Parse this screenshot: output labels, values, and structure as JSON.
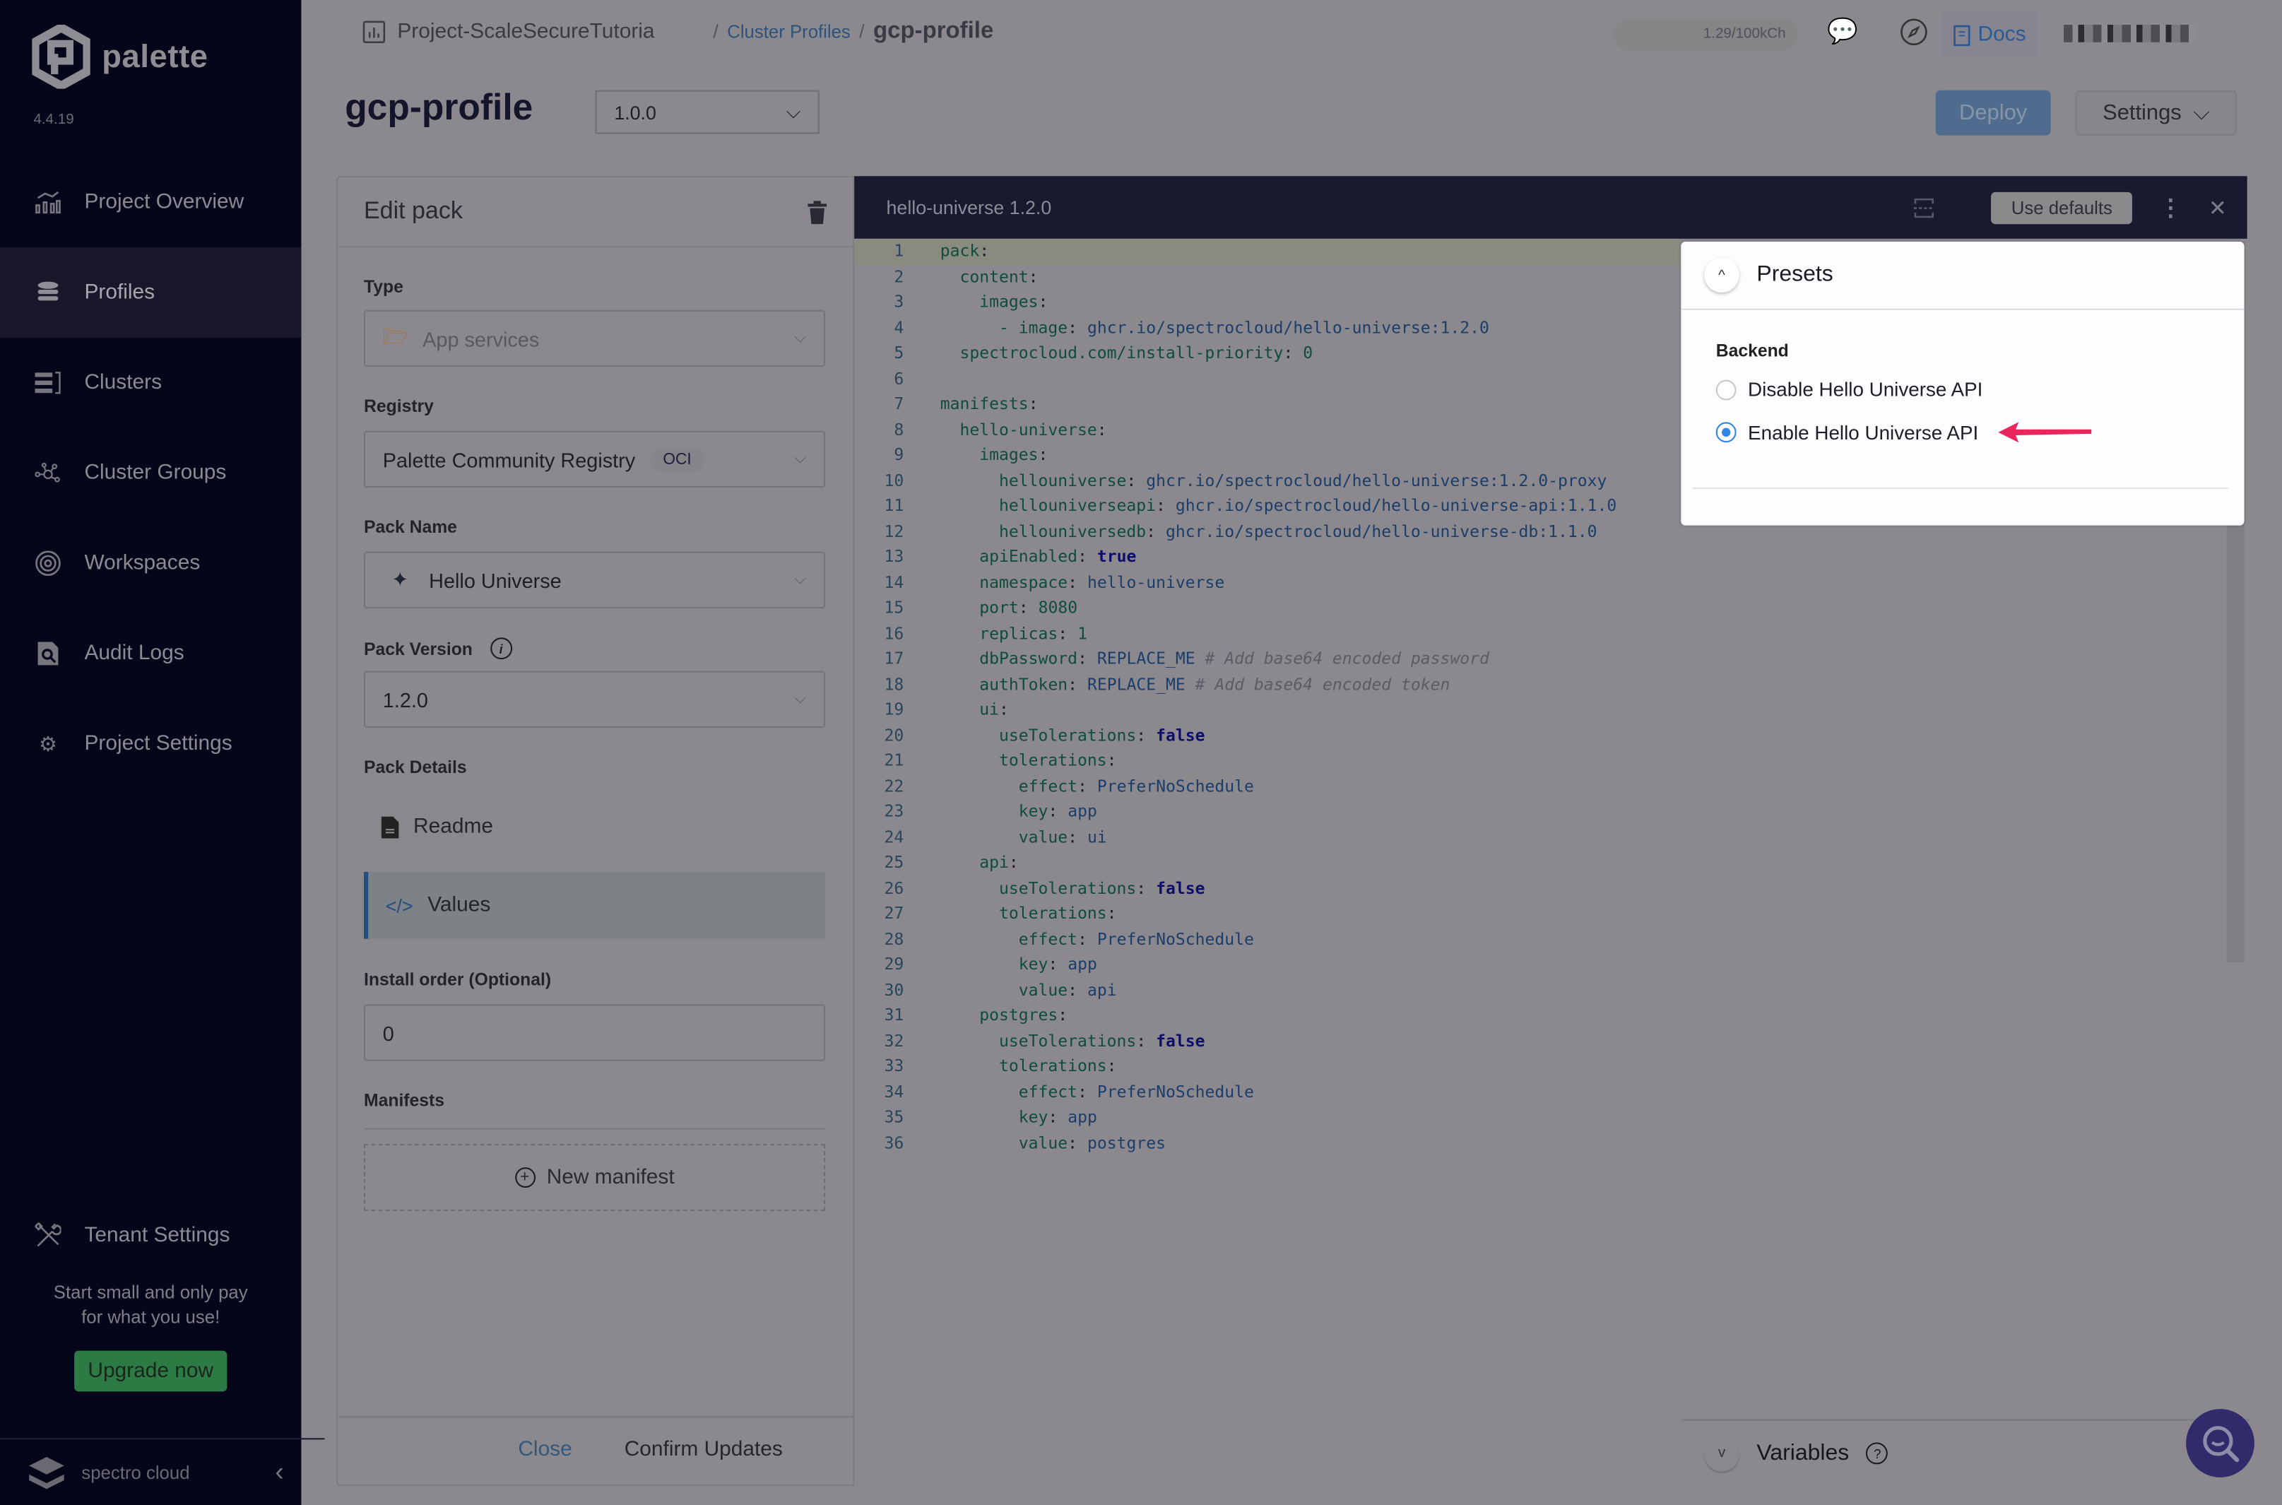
{
  "app": {
    "name": "palette",
    "version": "4.4.19"
  },
  "sidebar": {
    "items": [
      {
        "label": "Project Overview",
        "icon": "chart-icon"
      },
      {
        "label": "Profiles",
        "icon": "stack-icon",
        "active": true
      },
      {
        "label": "Clusters",
        "icon": "server-icon"
      },
      {
        "label": "Cluster Groups",
        "icon": "network-icon"
      },
      {
        "label": "Workspaces",
        "icon": "target-icon"
      },
      {
        "label": "Audit Logs",
        "icon": "audit-icon"
      },
      {
        "label": "Project Settings",
        "icon": "gear-icon"
      }
    ],
    "tenant_settings": "Tenant Settings",
    "promo_line1": "Start small and only pay",
    "promo_line2": "for what you use!",
    "upgrade_label": "Upgrade now",
    "footer_brand": "spectro cloud"
  },
  "header": {
    "project": "Project-ScaleSecureTutoria",
    "breadcrumb_sep": "/",
    "breadcrumb_link": "Cluster Profiles",
    "breadcrumb_current": "gcp-profile",
    "usage": "1.29/100kCh",
    "docs_label": "Docs"
  },
  "profile": {
    "title": "gcp-profile",
    "version": "1.0.0",
    "deploy_label": "Deploy",
    "settings_label": "Settings"
  },
  "edit_pack": {
    "title": "Edit pack",
    "type_label": "Type",
    "type_value": "App services",
    "registry_label": "Registry",
    "registry_value": "Palette Community Registry",
    "registry_badge": "OCI",
    "pack_name_label": "Pack Name",
    "pack_name_value": "Hello Universe",
    "pack_version_label": "Pack Version",
    "pack_version_value": "1.2.0",
    "pack_details_label": "Pack Details",
    "readme_label": "Readme",
    "values_label": "Values",
    "install_order_label": "Install order (Optional)",
    "install_order_value": "0",
    "manifests_label": "Manifests",
    "new_manifest_label": "New manifest",
    "close_label": "Close",
    "confirm_label": "Confirm Updates"
  },
  "editor": {
    "title": "hello-universe 1.2.0",
    "use_defaults_label": "Use defaults",
    "lines": [
      {
        "indent": 0,
        "key": "pack",
        "value": ""
      },
      {
        "indent": 1,
        "key": "content",
        "value": ""
      },
      {
        "indent": 2,
        "key": "images",
        "value": ""
      },
      {
        "indent": 3,
        "key": "- image",
        "value": "ghcr.io/spectrocloud/hello-universe:1.2.0"
      },
      {
        "indent": 1,
        "key": "spectrocloud.com/install-priority",
        "value": "0",
        "type": "num"
      },
      {
        "indent": 0,
        "key": "",
        "value": ""
      },
      {
        "indent": 0,
        "key": "manifests",
        "value": ""
      },
      {
        "indent": 1,
        "key": "hello-universe",
        "value": ""
      },
      {
        "indent": 2,
        "key": "images",
        "value": ""
      },
      {
        "indent": 3,
        "key": "hellouniverse",
        "value": "ghcr.io/spectrocloud/hello-universe:1.2.0-proxy"
      },
      {
        "indent": 3,
        "key": "hellouniverseapi",
        "value": "ghcr.io/spectrocloud/hello-universe-api:1.1.0"
      },
      {
        "indent": 3,
        "key": "hellouniversedb",
        "value": "ghcr.io/spectrocloud/hello-universe-db:1.1.0"
      },
      {
        "indent": 2,
        "key": "apiEnabled",
        "value": "true",
        "type": "bool"
      },
      {
        "indent": 2,
        "key": "namespace",
        "value": "hello-universe"
      },
      {
        "indent": 2,
        "key": "port",
        "value": "8080",
        "type": "num"
      },
      {
        "indent": 2,
        "key": "replicas",
        "value": "1",
        "type": "num"
      },
      {
        "indent": 2,
        "key": "dbPassword",
        "value": "REPLACE_ME",
        "comment": "# Add base64 encoded password"
      },
      {
        "indent": 2,
        "key": "authToken",
        "value": "REPLACE_ME",
        "comment": "# Add base64 encoded token"
      },
      {
        "indent": 2,
        "key": "ui",
        "value": ""
      },
      {
        "indent": 3,
        "key": "useTolerations",
        "value": "false",
        "type": "bool"
      },
      {
        "indent": 3,
        "key": "tolerations",
        "value": ""
      },
      {
        "indent": 4,
        "key": "effect",
        "value": "PreferNoSchedule"
      },
      {
        "indent": 4,
        "key": "key",
        "value": "app"
      },
      {
        "indent": 4,
        "key": "value",
        "value": "ui"
      },
      {
        "indent": 2,
        "key": "api",
        "value": ""
      },
      {
        "indent": 3,
        "key": "useTolerations",
        "value": "false",
        "type": "bool"
      },
      {
        "indent": 3,
        "key": "tolerations",
        "value": ""
      },
      {
        "indent": 4,
        "key": "effect",
        "value": "PreferNoSchedule"
      },
      {
        "indent": 4,
        "key": "key",
        "value": "app"
      },
      {
        "indent": 4,
        "key": "value",
        "value": "api"
      },
      {
        "indent": 2,
        "key": "postgres",
        "value": ""
      },
      {
        "indent": 3,
        "key": "useTolerations",
        "value": "false",
        "type": "bool"
      },
      {
        "indent": 3,
        "key": "tolerations",
        "value": ""
      },
      {
        "indent": 4,
        "key": "effect",
        "value": "PreferNoSchedule"
      },
      {
        "indent": 4,
        "key": "key",
        "value": "app"
      },
      {
        "indent": 4,
        "key": "value",
        "value": "postgres"
      }
    ]
  },
  "presets": {
    "title": "Presets",
    "group_label": "Backend",
    "options": [
      {
        "label": "Disable Hello Universe API",
        "selected": false
      },
      {
        "label": "Enable Hello Universe API",
        "selected": true
      }
    ],
    "annotation_color": "#e8255d",
    "radio_color": "#2f86e6"
  },
  "variables": {
    "title": "Variables"
  }
}
